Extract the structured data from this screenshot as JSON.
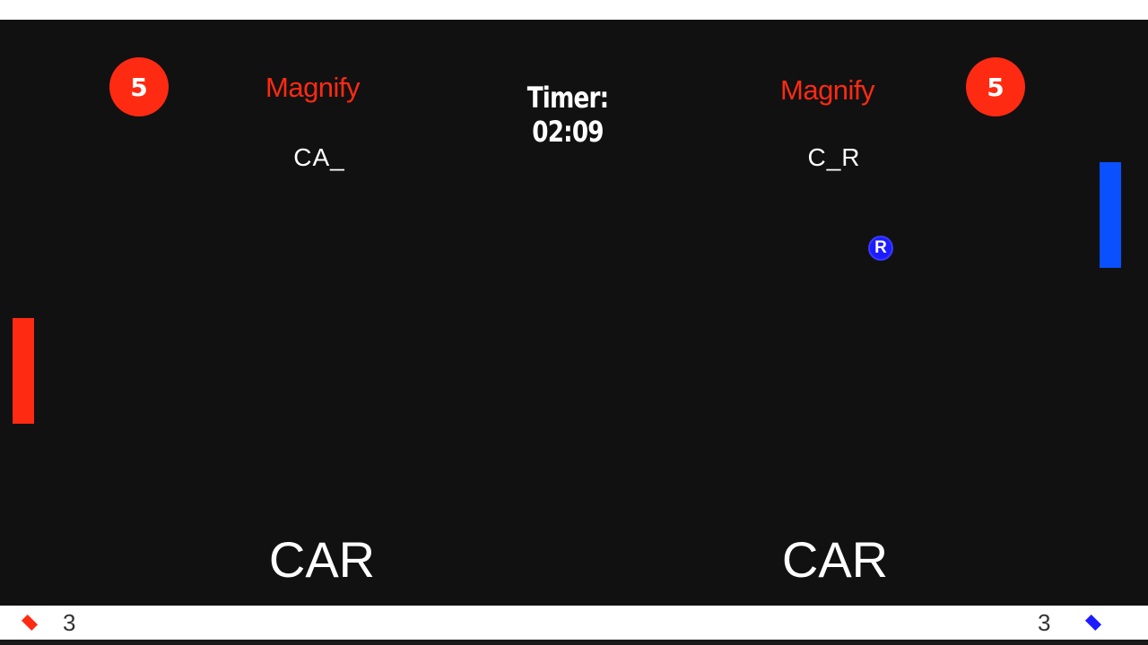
{
  "colors": {
    "arena_background": "#111112",
    "left_player": "#ff2a12",
    "right_player": "#0a50ff",
    "ball": "#1c1cff",
    "text": "#ffffff"
  },
  "timer": {
    "text": "Timer: 02:09"
  },
  "left_player": {
    "score": "5",
    "powerup_label": "Magnify",
    "word_progress": "CA_",
    "target_word": "CAR",
    "lives": "3",
    "life_icon": "red-diamond-icon"
  },
  "right_player": {
    "score": "5",
    "powerup_label": "Magnify",
    "word_progress": "C_R",
    "target_word": "CAR",
    "lives": "3",
    "life_icon": "blue-diamond-icon"
  },
  "ball": {
    "letter": "R"
  }
}
